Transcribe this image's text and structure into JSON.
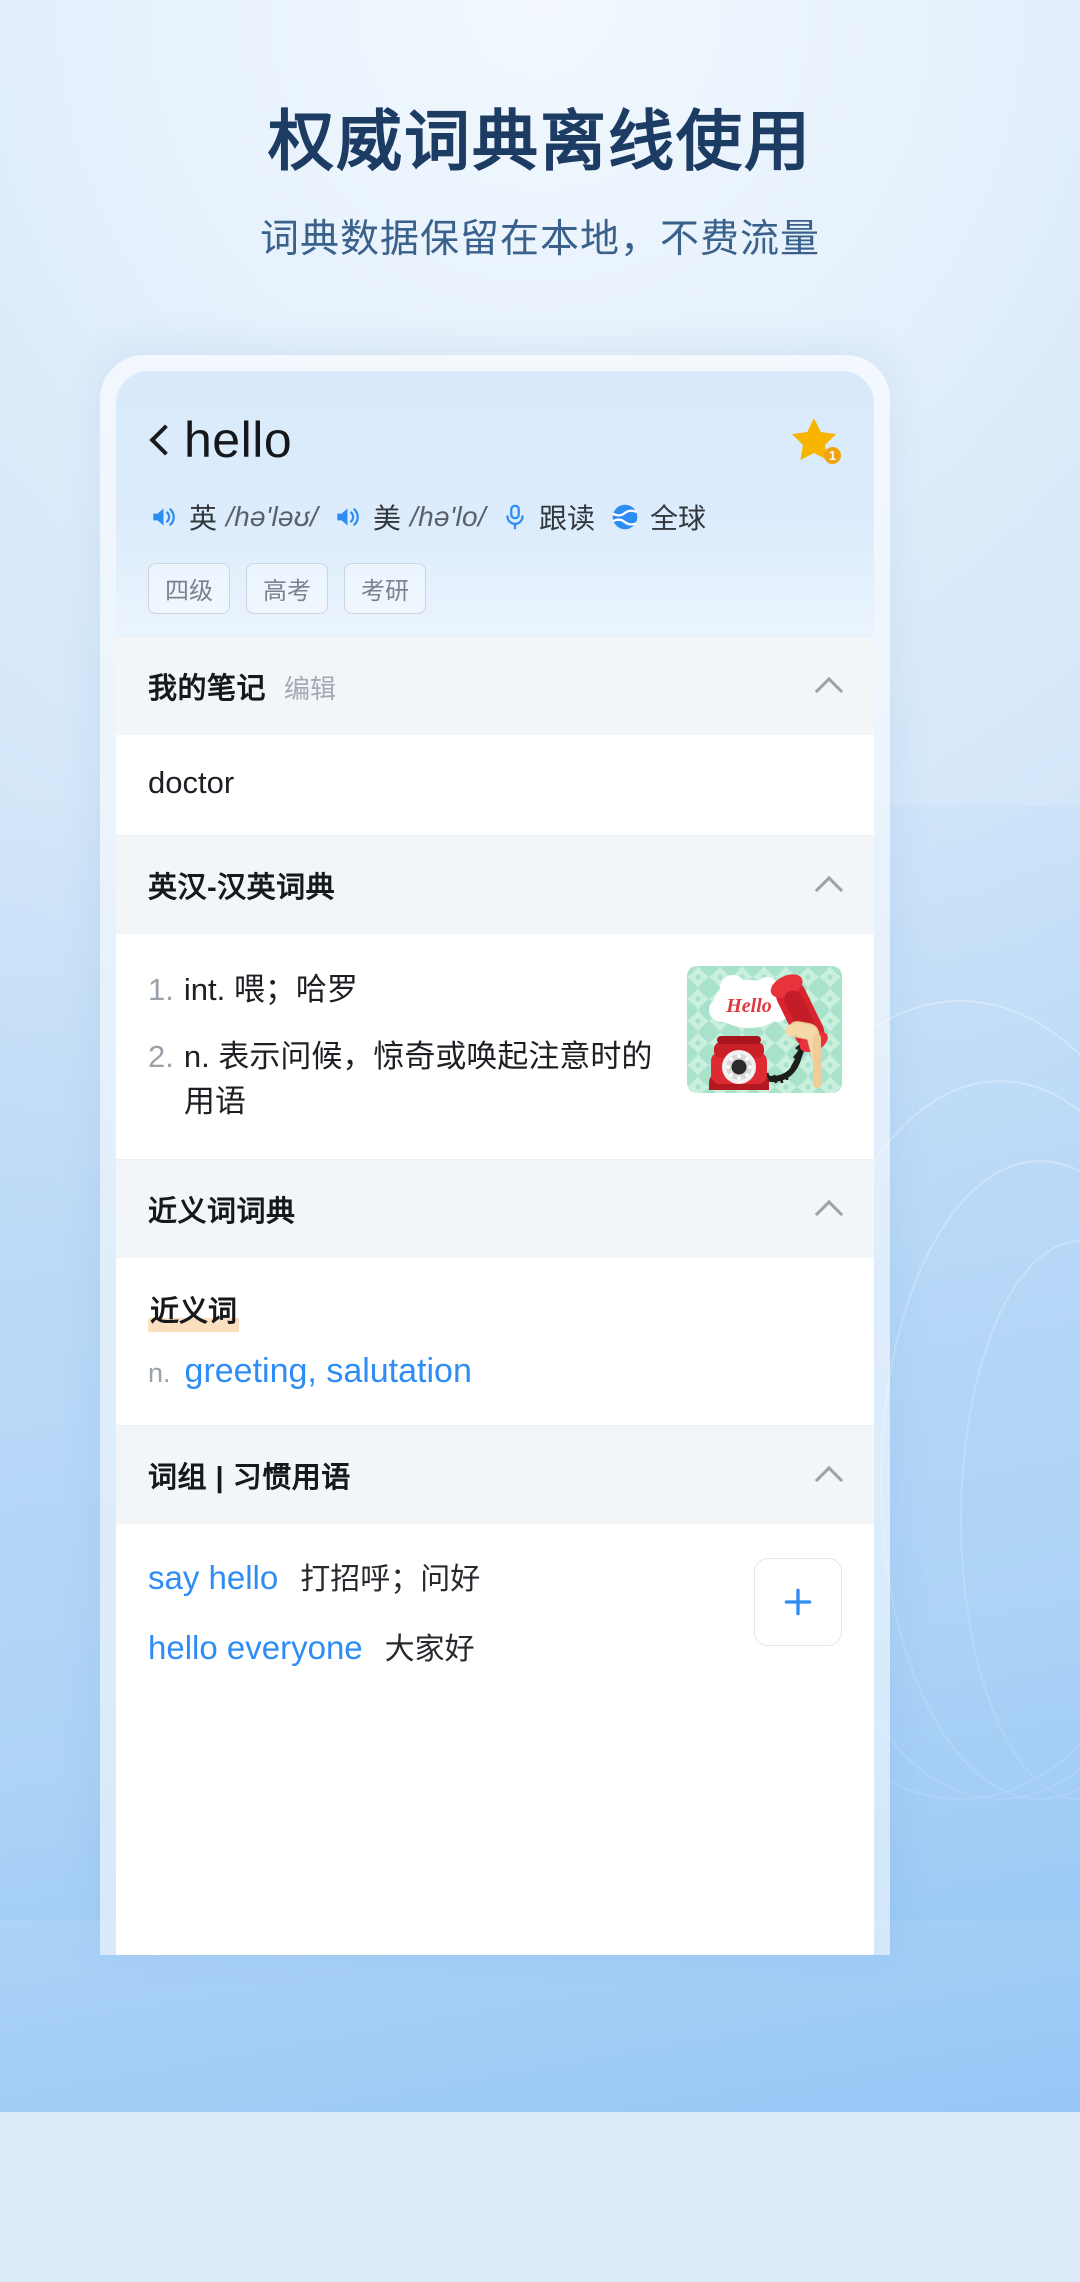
{
  "promo": {
    "title": "权威词典离线使用",
    "subtitle": "词典数据保留在本地，不费流量",
    "colors": {
      "title": "#1d3c63",
      "subtitle": "#39618c",
      "accent": "#2e8cf5",
      "star": "#f7b500"
    }
  },
  "app": {
    "header": {
      "back_icon": "chevron-left-icon",
      "headword": "hello",
      "favorite": {
        "icon": "star-icon",
        "badge": "1",
        "color": "#f7b500"
      },
      "pronunciations": [
        {
          "speaker_icon": "speaker-icon",
          "label": "英",
          "ipa": "/hə'ləʊ/"
        },
        {
          "speaker_icon": "speaker-icon",
          "label": "美",
          "ipa": "/hə'lo/"
        }
      ],
      "actions": [
        {
          "icon": "microphone-icon",
          "label": "跟读"
        },
        {
          "icon": "globe-icon",
          "label": "全球"
        }
      ],
      "tags": [
        "四级",
        "高考",
        "考研"
      ]
    },
    "sections": [
      {
        "id": "my-notes",
        "title": "我的笔记",
        "action": "编辑",
        "collapse_icon": "chevron-up-icon",
        "note": "doctor"
      },
      {
        "id": "ec-ce-dictionary",
        "title": "英汉-汉英词典",
        "collapse_icon": "chevron-up-icon",
        "definitions": [
          {
            "num": "1.",
            "text": "int. 喂；哈罗"
          },
          {
            "num": "2.",
            "text": "n. 表示问候，惊奇或唤起注意时的用语"
          }
        ],
        "thumbnail": {
          "name": "hello-telephone-illustration",
          "caption": "Hello"
        }
      },
      {
        "id": "synonym-dictionary",
        "title": "近义词词典",
        "collapse_icon": "chevron-up-icon",
        "group_label": "近义词",
        "pos": "n.",
        "words": [
          "greeting",
          "salutation"
        ]
      },
      {
        "id": "phrases-idioms",
        "title": "词组 | 习惯用语",
        "collapse_icon": "chevron-up-icon",
        "add_icon": "plus-icon",
        "phrases": [
          {
            "en": "say hello",
            "cn": "打招呼；问好"
          },
          {
            "en": "hello everyone",
            "cn": "大家好"
          }
        ]
      }
    ]
  }
}
